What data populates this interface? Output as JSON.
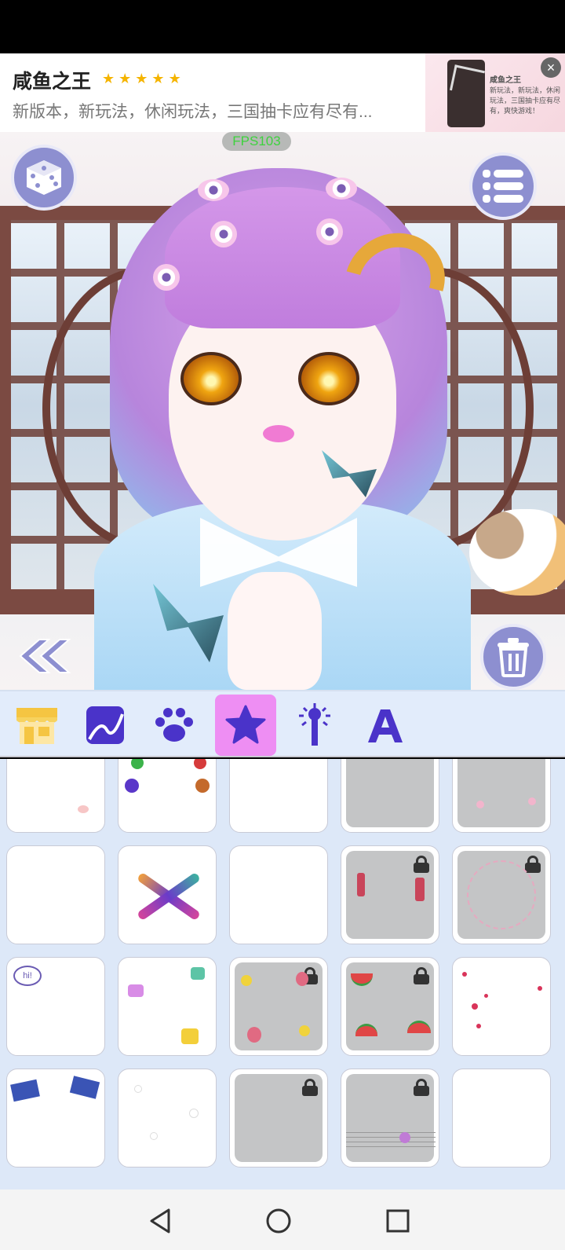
{
  "ad": {
    "title": "咸鱼之王",
    "rating_stars": 5,
    "description": "新版本，新玩法，休闲玩法，三国抽卡应有尽有...",
    "thumb_title": "咸鱼之王",
    "thumb_text": "新玩法，新玩法，休闲玩法，三国抽卡应有尽有，爽快游戏！"
  },
  "game": {
    "fps_label": "FPS103"
  },
  "toolbar": {
    "tabs": [
      {
        "name": "shop",
        "icon": "shop-icon",
        "active": false
      },
      {
        "name": "background",
        "icon": "picture-icon",
        "active": false
      },
      {
        "name": "pet",
        "icon": "paw-icon",
        "active": false
      },
      {
        "name": "sticker",
        "icon": "star-icon",
        "active": true
      },
      {
        "name": "effect",
        "icon": "magic-wand-icon",
        "active": false
      },
      {
        "name": "text",
        "icon": "letter-a-icon",
        "active": false
      }
    ]
  },
  "items_grid": {
    "columns": 5,
    "rows": [
      [
        {
          "locked": false
        },
        {
          "locked": false
        },
        {
          "locked": false
        },
        {
          "locked": true
        },
        {
          "locked": true
        }
      ],
      [
        {
          "locked": false
        },
        {
          "locked": false
        },
        {
          "locked": false
        },
        {
          "locked": true
        },
        {
          "locked": true
        }
      ],
      [
        {
          "locked": false
        },
        {
          "locked": false
        },
        {
          "locked": true
        },
        {
          "locked": true
        },
        {
          "locked": false
        }
      ],
      [
        {
          "locked": false
        },
        {
          "locked": false
        },
        {
          "locked": true
        },
        {
          "locked": true
        },
        {
          "locked": false
        }
      ]
    ],
    "speech_bubble_text": "hi!"
  },
  "colors": {
    "accent_button": "#8d8fd0",
    "active_tab": "#ee8ef3",
    "tab_icon": "#4a33c9",
    "fps_text": "#3ed23e"
  }
}
